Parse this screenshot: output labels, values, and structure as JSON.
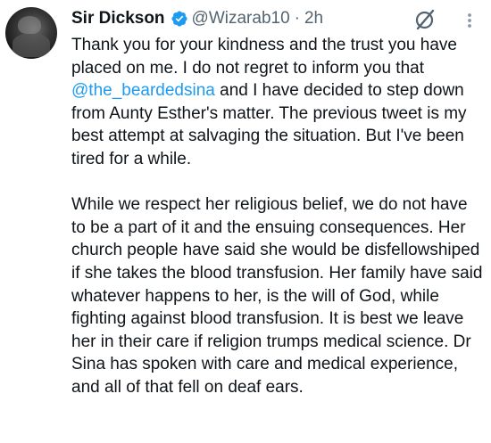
{
  "author": {
    "name": "Sir Dickson",
    "handle": "@Wizarab10",
    "separator": "·",
    "time": "2h",
    "verified_color": "#1d9bf0"
  },
  "icons": {
    "avatar": "profile-photo",
    "verified": "verified-badge-icon",
    "grok": "grok-icon",
    "more": "more-options-icon"
  },
  "tweet": {
    "p1_before": "Thank you for your kindness and the trust you have placed on me. I do not regret to inform you that ",
    "p1_mention": "@the_beardedsina",
    "p1_after": " and I have decided to step down from Aunty Esther's matter. The previous tweet is my best attempt at salvaging the situation. But I've been tired for a while.",
    "p2": "While we respect her religious belief, we do not have to be a part of it and the ensuing consequences. Her church people have said she would be disfellowshiped if she takes the blood transfusion. Her family have said whatever happens to her, is the will of God, while fighting against blood transfusion. It is best we leave her in their care if religion trumps medical science. Dr Sina has spoken  with care and medical experience, and all of that fell on deaf ears."
  }
}
